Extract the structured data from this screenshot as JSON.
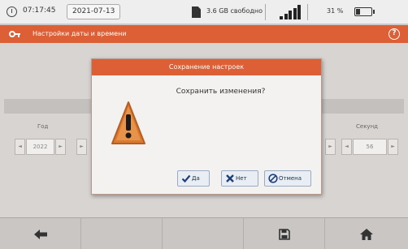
{
  "status_bar": {
    "time": "07:17:45",
    "date": "2021-07-13",
    "memory": "3.6 GB свободно",
    "battery_percent": "31 %",
    "battery_level": 0.31,
    "signal_bars": 5
  },
  "title_bar": {
    "title": "Настройки даты и времени"
  },
  "background": {
    "year_label": "Год",
    "year_value": "2022",
    "seconds_label": "Секунд",
    "seconds_value": "56"
  },
  "dialog": {
    "title": "Сохранение настроек",
    "question": "Сохранить изменения?",
    "yes_label": "Да",
    "no_label": "Нет",
    "cancel_label": "Отмена"
  },
  "toolbar": {
    "icons": [
      "arrow-left-icon",
      "save-icon",
      "home-icon"
    ]
  },
  "colors": {
    "accent": "#dc5f35",
    "button_bg": "#e9eef5"
  }
}
